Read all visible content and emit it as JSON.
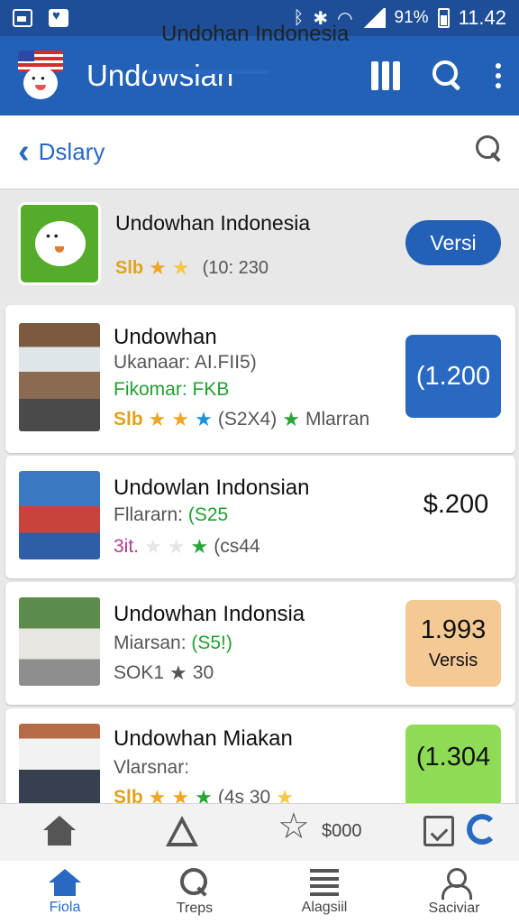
{
  "status_bar": {
    "battery_text": "91%",
    "time": "11.42"
  },
  "app_bar": {
    "title": "Undowsian"
  },
  "tabs": {
    "back_label": "Dslary",
    "active_tab": "Undohan Indonesia"
  },
  "featured": {
    "title": "Undowhan Indonesia",
    "rating_text": "Slb",
    "review_text": "(10: 230",
    "button_label": "Versi",
    "accent_color": "#2261b6"
  },
  "items": [
    {
      "title": "Undowhan",
      "line1": "Ukanaar: AI.FII5)",
      "line2": "Fikomar: FKB",
      "rating_text": "Slb",
      "review_text": "(S2X4)",
      "extra_text": "Mlarran",
      "price": "(1.200",
      "price_color": "#2a69c2"
    },
    {
      "title": "Undowlan Indonsian",
      "line1_label": "Fllararn:",
      "line1_value": "(S25",
      "rating_text": "3it.",
      "review_text": "(cs44",
      "price": "$.200"
    },
    {
      "title": "Undowhan Indonsia",
      "line1_label": "Miarsan:",
      "line1_value": "(S5!)",
      "rating_text": "SOK1",
      "review_text": "30",
      "price": "1.993",
      "price_sub": "Versis",
      "price_color": "#f5c993"
    },
    {
      "title": "Undowhan Miakan",
      "line1": "Vlarsnar:",
      "rating_text": "Slb",
      "review_text": "(4s 30",
      "price": "(1.304",
      "price_color": "#8edb55"
    }
  ],
  "toolbar": {
    "money_label": "$000"
  },
  "bottom_nav": [
    {
      "label": "Fiola"
    },
    {
      "label": "Treps"
    },
    {
      "label": "Alagsiil"
    },
    {
      "label": "Saciviar"
    }
  ]
}
